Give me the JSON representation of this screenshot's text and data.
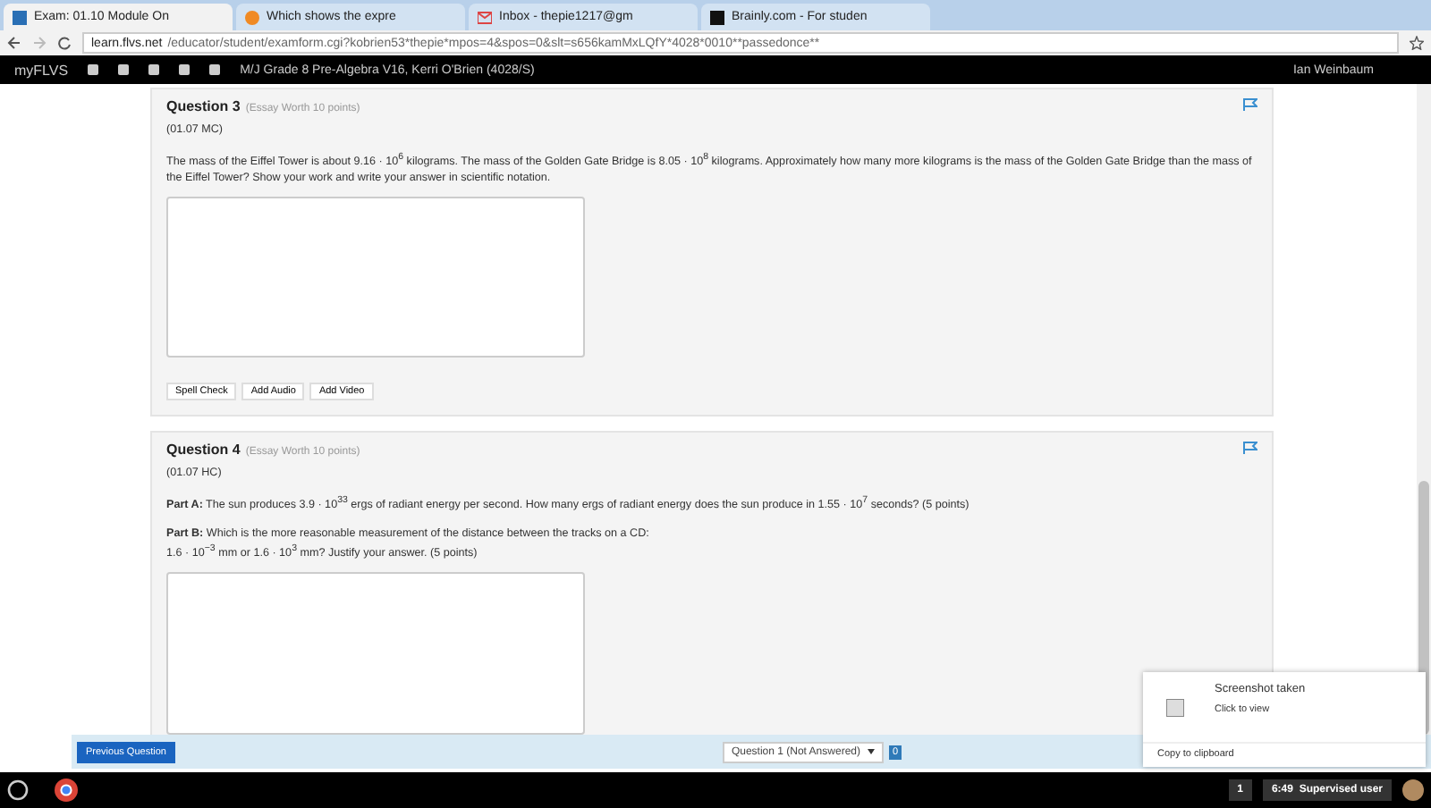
{
  "browser_tabs": [
    {
      "title": "Exam: 01.10 Module On",
      "selected": true
    },
    {
      "title": "Which shows the expre",
      "selected": false
    },
    {
      "title": "Inbox - thepie1217@gm",
      "selected": false
    },
    {
      "title": "Brainly.com - For studen",
      "selected": false
    }
  ],
  "address": {
    "host": "learn.flvs.net",
    "path": "/educator/student/examform.cgi?kobrien53*thepie*mpos=4&spos=0&slt=s656kamMxLQfY*4028*0010**passedonce**"
  },
  "nav": {
    "brand": "myFLVS",
    "course": "M/J Grade 8 Pre-Algebra V16, Kerri O'Brien (4028/S)",
    "user": "Ian Weinbaum"
  },
  "questions": [
    {
      "title": "Question 3",
      "worth": "(Essay Worth 10 points)",
      "code": "(01.07 MC)",
      "paragraphs": [
        "The mass of the Eiffel Tower is about 9.16 · 10$^{6}$ kilograms. The mass of the Golden Gate Bridge is 8.05 · 10$^{8}$ kilograms. Approximately how many more kilograms is the mass of the Golden Gate Bridge than the mass of the Eiffel Tower? Show your work and write your answer in scientific notation."
      ],
      "tools": [
        "Spell Check",
        "Add Audio",
        "Add Video"
      ]
    },
    {
      "title": "Question 4",
      "worth": "(Essay Worth 10 points)",
      "code": "(01.07 HC)",
      "paragraphs": [
        "**Part A:** The sun produces 3.9 · 10$^{33}$ ergs of radiant energy per second. How many ergs of radiant energy does the sun produce in 1.55 · 10$^{7}$ seconds? (5 points)",
        "**Part B:** Which is the more reasonable measurement of the distance between the tracks on a CD:",
        "1.6 · 10$^{−3}$ mm or 1.6 · 10$^{3}$ mm? Justify your answer. (5 points)"
      ]
    }
  ],
  "footer": {
    "previous": "Previous Question",
    "select": "Question 1 (Not Answered)",
    "flag_count": "0"
  },
  "notification": {
    "title": "Screenshot taken",
    "subtitle": "Click to view",
    "action": "Copy to clipboard"
  },
  "taskbar": {
    "badge": "1",
    "time": "6:49",
    "user": "Supervised user"
  }
}
